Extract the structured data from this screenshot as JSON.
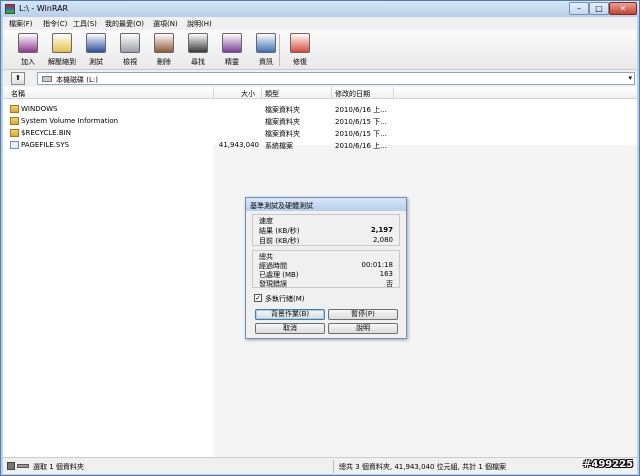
{
  "window": {
    "title": "L:\\ - WinRAR",
    "btn_min": "–",
    "btn_max": "□",
    "btn_close": "✕"
  },
  "menu": [
    "檔案(F)",
    "指令(C)",
    "工具(S)",
    "我的最愛(O)",
    "選項(N)",
    "說明(H)"
  ],
  "toolbar": [
    {
      "label": "加入",
      "icon": "add-archive-icon",
      "color": "#8b3a8f"
    },
    {
      "label": "解壓縮到",
      "icon": "extract-to-icon",
      "color": "#e4c04a"
    },
    {
      "label": "測試",
      "icon": "test-icon",
      "color": "#2b4f9e"
    },
    {
      "label": "檢視",
      "icon": "view-icon",
      "color": "#9aa0a8"
    },
    {
      "label": "刪除",
      "icon": "delete-icon",
      "color": "#8e5a3a"
    },
    {
      "label": "尋找",
      "icon": "find-icon",
      "color": "#3a3a3a"
    },
    {
      "label": "精靈",
      "icon": "wizard-icon",
      "color": "#7b3f99"
    },
    {
      "label": "資訊",
      "icon": "info-icon",
      "color": "#3a6fb5"
    },
    {
      "label": "修復",
      "icon": "repair-icon",
      "color": "#d94a3a"
    }
  ],
  "address": {
    "up_glyph": "⬆",
    "path": "本機磁碟 (L:)",
    "dropdown": "▾"
  },
  "columns": {
    "name": "名稱",
    "size": "大小",
    "type": "類型",
    "modified": "修改的日期"
  },
  "files": [
    {
      "name": "WINDOWS",
      "size": "",
      "type": "檔案資料夾",
      "date": "2010/6/16 上...",
      "kind": "folder"
    },
    {
      "name": "System Volume Information",
      "size": "",
      "type": "檔案資料夾",
      "date": "2010/6/15 下...",
      "kind": "folder"
    },
    {
      "name": "$RECYCLE.BIN",
      "size": "",
      "type": "檔案資料夾",
      "date": "2010/6/15 下...",
      "kind": "folder"
    },
    {
      "name": "PAGEFILE.SYS",
      "size": "41,943,040",
      "type": "系統檔案",
      "date": "2010/6/16 上...",
      "kind": "file"
    }
  ],
  "status": {
    "left": "選取 1 個資料夾",
    "right": "總共 3 個資料夾, 41,943,040 位元組, 共計 1 個檔案"
  },
  "watermark": "#499225",
  "dialog": {
    "title": "基準測試及硬體測試",
    "speed_group": "速度",
    "result_label": "結果 (KB/秒)",
    "result_value": "2,197",
    "current_label": "目前 (KB/秒)",
    "current_value": "2,080",
    "stats_group": "總共",
    "elapsed_label": "經過時間",
    "elapsed_value": "00:01:18",
    "processed_label": "已處理 (MB)",
    "processed_value": "163",
    "errors_label": "發現錯誤",
    "errors_value": "否",
    "multithread_check": "✓",
    "multithread_label": "多執行緒(M)",
    "background_btn": "背景作業(B)",
    "pause_btn": "暫停(P)",
    "cancel_btn": "取消",
    "help_btn": "說明"
  }
}
